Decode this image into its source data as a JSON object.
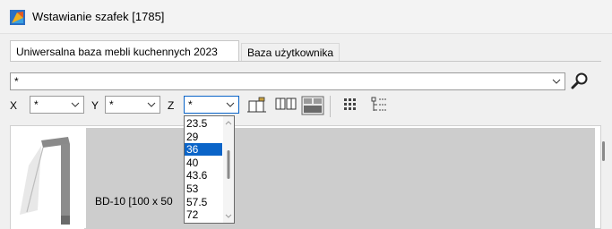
{
  "window": {
    "title": "Wstawianie szafek [1785]"
  },
  "tabs": [
    {
      "label": "Uniwersalna baza mebli kuchennych 2023"
    },
    {
      "label": "Baza użytkownika"
    }
  ],
  "search": {
    "value": "*"
  },
  "filters": {
    "x_label": "X",
    "x_value": "*",
    "y_label": "Y",
    "y_value": "*",
    "z_label": "Z",
    "z_value": "*"
  },
  "dropdown": {
    "options": [
      "23.5",
      "29",
      "36",
      "40",
      "43.6",
      "53",
      "57.5",
      "72"
    ],
    "selected": "36"
  },
  "list": {
    "item_text": "BD-10  [100 x 50"
  },
  "colors": {
    "selection": "#0a64c8",
    "list_item_bg": "#cdcdcd"
  }
}
